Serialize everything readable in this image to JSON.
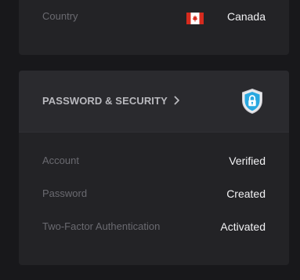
{
  "country": {
    "label": "Country",
    "value": "Canada",
    "flag_icon": "canada-flag-icon"
  },
  "security": {
    "title": "PASSWORD & SECURITY",
    "chevron_icon": "chevron-right-icon",
    "badge_icon": "shield-lock-icon",
    "rows": [
      {
        "label": "Account",
        "value": "Verified"
      },
      {
        "label": "Password",
        "value": "Created"
      },
      {
        "label": "Two-Factor Authentication",
        "value": "Activated"
      }
    ]
  },
  "colors": {
    "background": "#18181b",
    "card": "#232326",
    "card_header": "#2a2a2e",
    "label": "#6a6a70",
    "value": "#f2f2f4",
    "shield_accent": "#29a8e0"
  }
}
